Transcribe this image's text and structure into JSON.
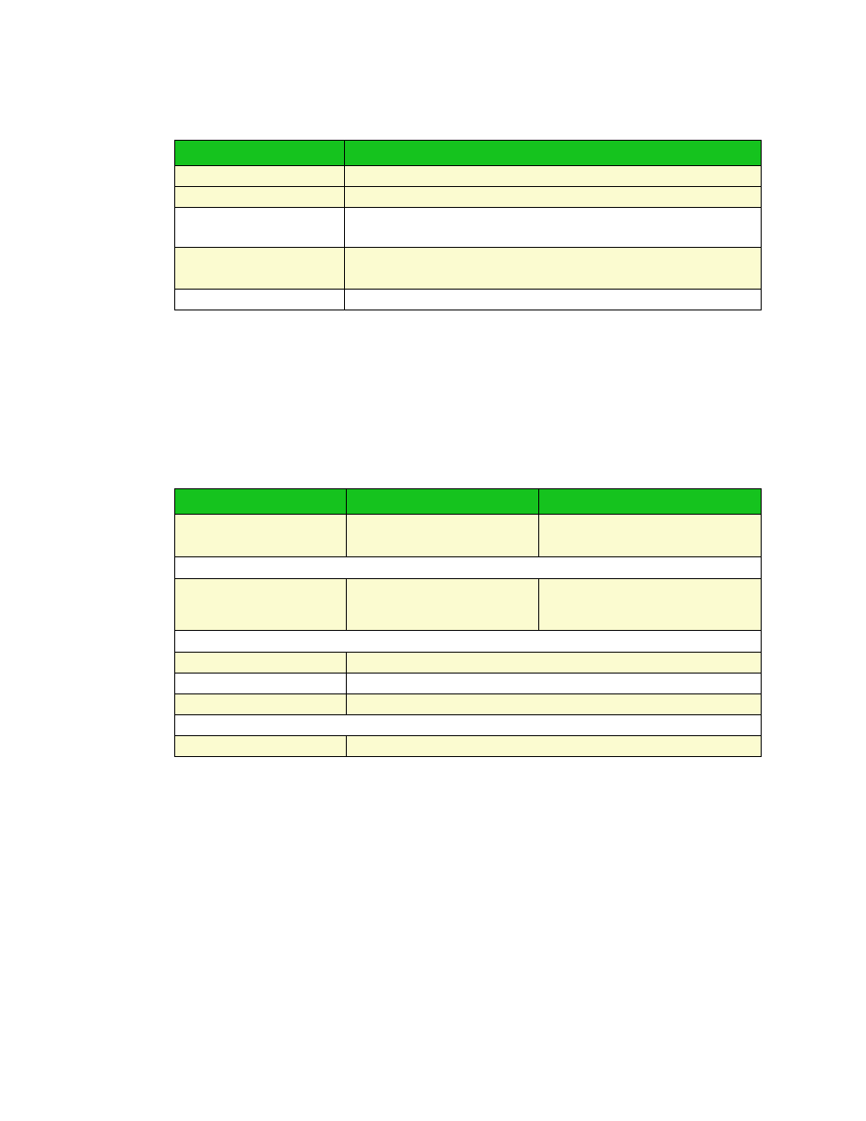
{
  "table1": {
    "header": [
      "",
      ""
    ],
    "rows": [
      {
        "c0": "",
        "c1": ""
      },
      {
        "c0": "",
        "c1": ""
      },
      {
        "c0": "",
        "c1": ""
      },
      {
        "c0": "",
        "c1": ""
      },
      {
        "c0": "",
        "c1": ""
      }
    ]
  },
  "table2": {
    "header": [
      "",
      "",
      ""
    ],
    "rows": [
      {
        "c0": "",
        "c1": "",
        "c2": ""
      },
      {
        "span": "",
        "full": true
      },
      {
        "c0": "",
        "c1": "",
        "c2": ""
      },
      {
        "span": "",
        "full": true
      },
      {
        "c0": "",
        "c12": ""
      },
      {
        "c0": "",
        "c12": ""
      },
      {
        "c0": "",
        "c12": ""
      },
      {
        "span": "",
        "full": true
      },
      {
        "c0": "",
        "c12": ""
      }
    ]
  }
}
